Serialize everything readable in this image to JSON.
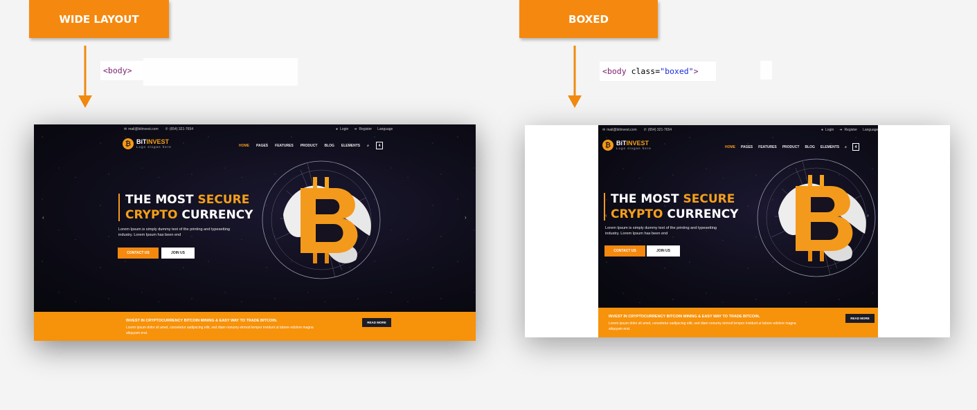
{
  "labels": {
    "wide": "WIDE LAYOUT",
    "boxed": "BOXED"
  },
  "code": {
    "wide": {
      "tag_open": "<body>",
      "tag_name": "body"
    },
    "boxed": {
      "tag_name": "body",
      "attr": "class",
      "value": "\"boxed\""
    }
  },
  "colors": {
    "accent": "#f5890f",
    "hero_bg": "#0d0c18",
    "strip": "#f7920b"
  },
  "site": {
    "email": "mail@bitinvest.com",
    "phone": "(654) 321-7654",
    "login": "Login",
    "register": "Register",
    "language": "Language",
    "brand_first": "BiT",
    "brand_second": "INVEST",
    "slogan": "Logo slogan here",
    "menu": [
      "HOME",
      "PAGES",
      "FEATURES",
      "PRODUCT",
      "BLOG",
      "ELEMENTS"
    ],
    "cart_count": "4",
    "headline_1a": "THE MOST ",
    "headline_1b": "SECURE",
    "headline_2a": "CRYPTO",
    "headline_2b": " CURRENCY",
    "lead": "Lorem Ipsum is simply dummy text of the printing and typesetting industry. Lorem Ipsum has been end",
    "contact_btn": "CONTACT US",
    "join_btn": "JOIN US",
    "strip_title": "INVEST IN CRYPTOCURRENCY BITCOIN MINING & EASY WAY TO TRADE BITCOIN.",
    "strip_desc": "Lorem ipsum dolor sit amet, consetetur sadipscing elitr, sed diam nonumy eirmod tempor invidunt ut labore edolore magna aliquyam erat.",
    "read_more": "READ MORE",
    "icons": [
      "envelope-icon",
      "phone-icon",
      "user-icon",
      "sign-in-icon",
      "search-icon",
      "cart-icon",
      "bitcoin-icon",
      "globe-icon"
    ]
  }
}
